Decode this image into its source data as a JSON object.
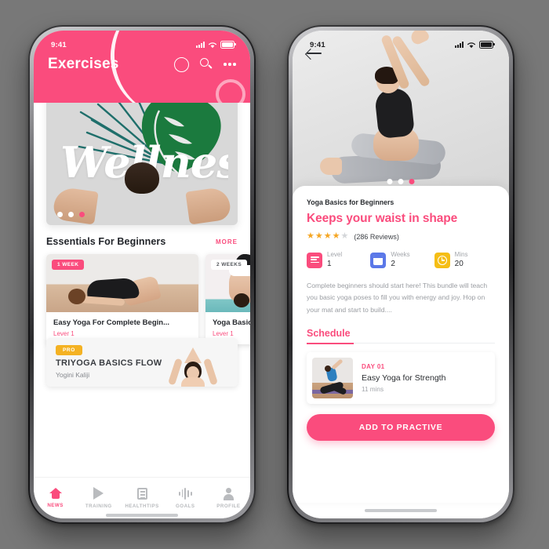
{
  "brand": {
    "pink": "#FA4C7D",
    "blue": "#5B78E8",
    "gold": "#F5BE16",
    "pro_yellow": "#F4B223"
  },
  "left_phone": {
    "status": {
      "time": "9:41",
      "signal_icon": "signal-bars-icon",
      "wifi_icon": "wifi-icon",
      "battery_icon": "battery-icon"
    },
    "header": {
      "title": "Exercises",
      "circle_icon": "circle-icon",
      "search_icon": "search-icon",
      "more_icon": "more-dots-icon"
    },
    "hero": {
      "script_text": "Wellness",
      "dots": [
        "inactive",
        "inactive",
        "active"
      ]
    },
    "section": {
      "title": "Essentials For Beginners",
      "more_label": "MORE"
    },
    "cards": [
      {
        "badge": "1 WEEK",
        "badge_style": "pink",
        "name": "Easy Yoga For Complete Begin...",
        "level": "Lever 1"
      },
      {
        "badge": "2 WEEKS",
        "badge_style": "white",
        "name": "Yoga Basics fo",
        "level": "Lever 1"
      }
    ],
    "pro_card": {
      "badge": "PRO",
      "title": "TRIYOGA BASICS FLOW",
      "author": "Yogini Kaliji"
    },
    "tabs": [
      {
        "label": "NEWS",
        "icon": "home-icon",
        "active": true
      },
      {
        "label": "TRAINING",
        "icon": "play-icon",
        "active": false
      },
      {
        "label": "HEALTHTIPS",
        "icon": "book-icon",
        "active": false
      },
      {
        "label": "GOALS",
        "icon": "waveform-icon",
        "active": false
      },
      {
        "label": "PROFILE",
        "icon": "user-icon",
        "active": false
      }
    ]
  },
  "right_phone": {
    "status": {
      "time": "9:41",
      "signal_icon": "signal-bars-icon",
      "wifi_icon": "wifi-icon",
      "battery_icon": "battery-icon"
    },
    "back_icon": "back-arrow-icon",
    "hero_dots": [
      "inactive",
      "inactive",
      "active"
    ],
    "detail": {
      "subtitle": "Yoga Basics for Beginners",
      "title": "Keeps your waist in shape",
      "rating_filled": 4,
      "rating_total": 5,
      "reviews": "(286 Reviews)",
      "stats": [
        {
          "key": "Level",
          "value": "1",
          "icon": "level-lines-icon",
          "color": "pink"
        },
        {
          "key": "Weeks",
          "value": "2",
          "icon": "calendar-icon",
          "color": "blue"
        },
        {
          "key": "Mins",
          "value": "20",
          "icon": "clock-icon",
          "color": "gold"
        }
      ],
      "description": "Complete beginners should start here! This bundle will teach you basic yoga poses to fill you with energy and joy. Hop on your mat and start to build....",
      "schedule_label": "Schedule",
      "schedule": [
        {
          "day": "DAY 01",
          "name": "Easy Yoga for Strength",
          "duration": "11 mins"
        }
      ],
      "cta_label": "ADD TO PRACTIVE"
    }
  }
}
